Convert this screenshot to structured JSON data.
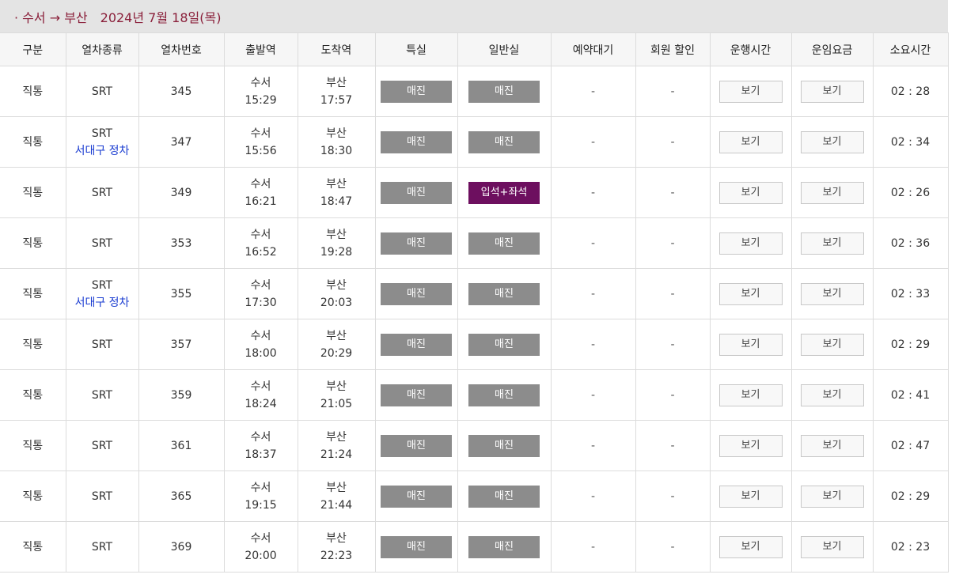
{
  "header": {
    "route": "· 수서 → 부산",
    "date": "2024년 7월 18일(목)"
  },
  "columns": [
    "구분",
    "열차종류",
    "열차번호",
    "출발역",
    "도착역",
    "특실",
    "일반실",
    "예약대기",
    "회원 할인",
    "운행시간",
    "운임요금",
    "소요시간"
  ],
  "rows": [
    {
      "type": "직통",
      "train": "SRT",
      "note": "",
      "no": "345",
      "dep_st": "수서",
      "dep_time": "15:29",
      "arr_st": "부산",
      "arr_time": "17:57",
      "special": "매진",
      "general": "매진",
      "general_style": "soldout",
      "wait": "-",
      "discount": "-",
      "run": "보기",
      "fare": "보기",
      "duration": "02 : 28"
    },
    {
      "type": "직통",
      "train": "SRT",
      "note": "서대구 정차",
      "no": "347",
      "dep_st": "수서",
      "dep_time": "15:56",
      "arr_st": "부산",
      "arr_time": "18:30",
      "special": "매진",
      "general": "매진",
      "general_style": "soldout",
      "wait": "-",
      "discount": "-",
      "run": "보기",
      "fare": "보기",
      "duration": "02 : 34"
    },
    {
      "type": "직통",
      "train": "SRT",
      "note": "",
      "no": "349",
      "dep_st": "수서",
      "dep_time": "16:21",
      "arr_st": "부산",
      "arr_time": "18:47",
      "special": "매진",
      "general": "입석+좌석",
      "general_style": "standing",
      "wait": "-",
      "discount": "-",
      "run": "보기",
      "fare": "보기",
      "duration": "02 : 26"
    },
    {
      "type": "직통",
      "train": "SRT",
      "note": "",
      "no": "353",
      "dep_st": "수서",
      "dep_time": "16:52",
      "arr_st": "부산",
      "arr_time": "19:28",
      "special": "매진",
      "general": "매진",
      "general_style": "soldout",
      "wait": "-",
      "discount": "-",
      "run": "보기",
      "fare": "보기",
      "duration": "02 : 36"
    },
    {
      "type": "직통",
      "train": "SRT",
      "note": "서대구 정차",
      "no": "355",
      "dep_st": "수서",
      "dep_time": "17:30",
      "arr_st": "부산",
      "arr_time": "20:03",
      "special": "매진",
      "general": "매진",
      "general_style": "soldout",
      "wait": "-",
      "discount": "-",
      "run": "보기",
      "fare": "보기",
      "duration": "02 : 33"
    },
    {
      "type": "직통",
      "train": "SRT",
      "note": "",
      "no": "357",
      "dep_st": "수서",
      "dep_time": "18:00",
      "arr_st": "부산",
      "arr_time": "20:29",
      "special": "매진",
      "general": "매진",
      "general_style": "soldout",
      "wait": "-",
      "discount": "-",
      "run": "보기",
      "fare": "보기",
      "duration": "02 : 29"
    },
    {
      "type": "직통",
      "train": "SRT",
      "note": "",
      "no": "359",
      "dep_st": "수서",
      "dep_time": "18:24",
      "arr_st": "부산",
      "arr_time": "21:05",
      "special": "매진",
      "general": "매진",
      "general_style": "soldout",
      "wait": "-",
      "discount": "-",
      "run": "보기",
      "fare": "보기",
      "duration": "02 : 41"
    },
    {
      "type": "직통",
      "train": "SRT",
      "note": "",
      "no": "361",
      "dep_st": "수서",
      "dep_time": "18:37",
      "arr_st": "부산",
      "arr_time": "21:24",
      "special": "매진",
      "general": "매진",
      "general_style": "soldout",
      "wait": "-",
      "discount": "-",
      "run": "보기",
      "fare": "보기",
      "duration": "02 : 47"
    },
    {
      "type": "직통",
      "train": "SRT",
      "note": "",
      "no": "365",
      "dep_st": "수서",
      "dep_time": "19:15",
      "arr_st": "부산",
      "arr_time": "21:44",
      "special": "매진",
      "general": "매진",
      "general_style": "soldout",
      "wait": "-",
      "discount": "-",
      "run": "보기",
      "fare": "보기",
      "duration": "02 : 29"
    },
    {
      "type": "직통",
      "train": "SRT",
      "note": "",
      "no": "369",
      "dep_st": "수서",
      "dep_time": "20:00",
      "arr_st": "부산",
      "arr_time": "22:23",
      "special": "매진",
      "general": "매진",
      "general_style": "soldout",
      "wait": "-",
      "discount": "-",
      "run": "보기",
      "fare": "보기",
      "duration": "02 : 23"
    }
  ],
  "colors": {
    "header_text": "#8a1f3a",
    "soldout_bg": "#8c8c8c",
    "standing_bg": "#6d0f5f",
    "note_text": "#1a3cd1"
  }
}
